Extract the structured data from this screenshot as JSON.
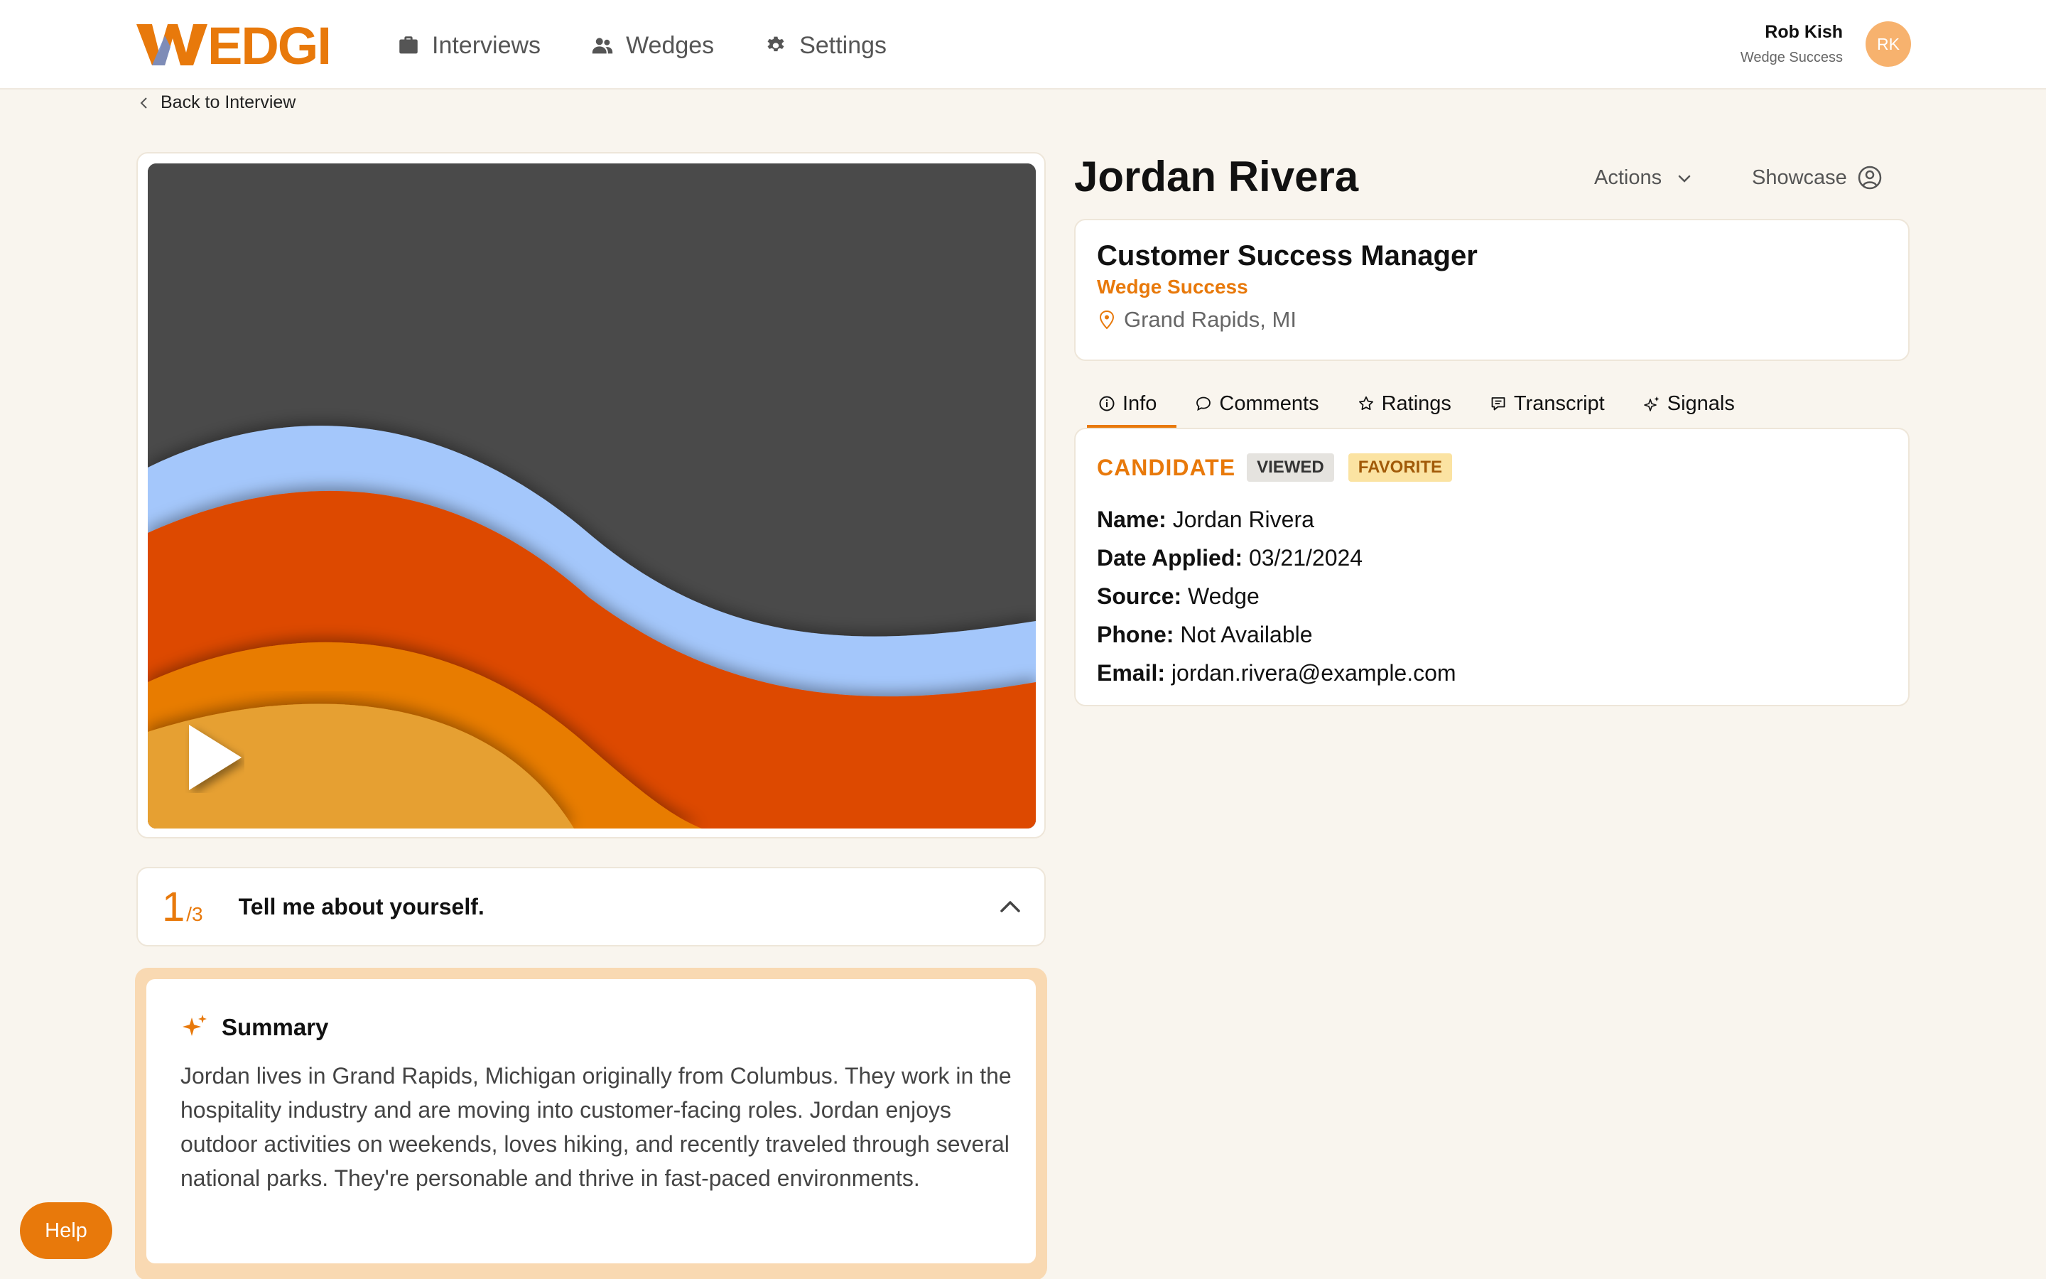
{
  "nav": {
    "items": [
      {
        "label": "Interviews",
        "icon": "briefcase-icon"
      },
      {
        "label": "Wedges",
        "icon": "users-icon"
      },
      {
        "label": "Settings",
        "icon": "gear-icon"
      }
    ]
  },
  "user": {
    "name": "Rob Kish",
    "company": "Wedge Success",
    "initials": "RK"
  },
  "back_label": "Back to Interview",
  "question": {
    "number": "1",
    "total": "/3",
    "text": "Tell me about yourself."
  },
  "summary": {
    "title": "Summary",
    "body": "Jordan lives in Grand Rapids, Michigan originally from Columbus. They work in the hospitality industry and are moving into customer-facing roles. Jordan enjoys outdoor activities on weekends, loves hiking, and recently traveled through several national parks. They're personable and thrive in fast-paced environments."
  },
  "help_label": "Help",
  "candidate": {
    "name": "Jordan Rivera",
    "actions_label": "Actions",
    "showcase_label": "Showcase"
  },
  "job": {
    "title": "Customer Success Manager",
    "company": "Wedge Success",
    "location": "Grand Rapids, MI"
  },
  "tabs": [
    {
      "label": "Info",
      "active": true
    },
    {
      "label": "Comments"
    },
    {
      "label": "Ratings"
    },
    {
      "label": "Transcript"
    },
    {
      "label": "Signals"
    }
  ],
  "info": {
    "section_label": "CANDIDATE",
    "badges": [
      "VIEWED",
      "FAVORITE"
    ],
    "rows": [
      {
        "label": "Name:",
        "value": "Jordan Rivera"
      },
      {
        "label": "Date Applied:",
        "value": "03/21/2024"
      },
      {
        "label": "Source:",
        "value": "Wedge"
      },
      {
        "label": "Phone:",
        "value": "Not Available"
      },
      {
        "label": "Email:",
        "value": "jordan.rivera@example.com"
      }
    ]
  },
  "colors": {
    "accent": "#e8790b",
    "background": "#f9f5ee",
    "wave_blue": "#a4c7fb",
    "wave_red": "#dd4a00",
    "wave_orange": "#e87b03",
    "wave_yellow": "#e6a030"
  }
}
